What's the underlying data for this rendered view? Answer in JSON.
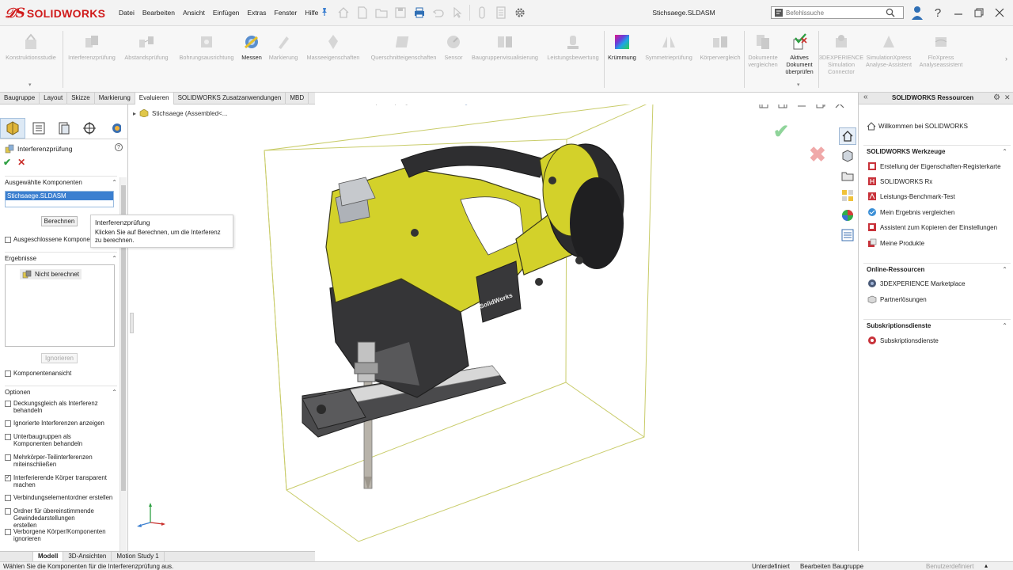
{
  "app": {
    "logo_text": "SOLIDWORKS",
    "document_title": "Stichsaege.SLDASM"
  },
  "menu": [
    "Datei",
    "Bearbeiten",
    "Ansicht",
    "Einfügen",
    "Extras",
    "Fenster",
    "Hilfe"
  ],
  "search": {
    "placeholder": "Befehlssuche"
  },
  "commands": [
    {
      "label": "Konstruktionsstudie",
      "enabled": false
    },
    {
      "label": "Interferenzprüfung",
      "enabled": false
    },
    {
      "label": "Abstandsprüfung",
      "enabled": false
    },
    {
      "label": "Bohrungsausrichtung",
      "enabled": false
    },
    {
      "label": "Messen",
      "enabled": true
    },
    {
      "label": "Markierung",
      "enabled": false
    },
    {
      "label": "Masseeigenschaften",
      "enabled": false
    },
    {
      "label": "Querschnitteigenschaften",
      "enabled": false
    },
    {
      "label": "Sensor",
      "enabled": false
    },
    {
      "label": "Baugruppenvisualisierung",
      "enabled": false
    },
    {
      "label": "Leistungsbewertung",
      "enabled": false
    },
    {
      "label": "Krümmung",
      "enabled": true
    },
    {
      "label": "Symmetrieprüfung",
      "enabled": false
    },
    {
      "label": "Körpervergleich",
      "enabled": false
    },
    {
      "label": "Dokumente vergleichen",
      "enabled": false
    },
    {
      "label": "Aktives Dokument überprüfen",
      "enabled": true
    },
    {
      "label": "3DEXPERIENCE Simulation Connector",
      "enabled": false
    },
    {
      "label": "SimulationXpress Analyse-Assistent",
      "enabled": false
    },
    {
      "label": "FloXpress Analyseassistent",
      "enabled": false
    }
  ],
  "tabs": [
    {
      "label": "Baugruppe",
      "selected": false
    },
    {
      "label": "Layout",
      "selected": false
    },
    {
      "label": "Skizze",
      "selected": false
    },
    {
      "label": "Markierung",
      "selected": false
    },
    {
      "label": "Evaluieren",
      "selected": true
    },
    {
      "label": "SOLIDWORKS Zusatzanwendungen",
      "selected": false
    },
    {
      "label": "MBD",
      "selected": false
    }
  ],
  "property_manager": {
    "title": "Interferenzprüfung",
    "help": "?",
    "ok": "✔",
    "cancel": "✕",
    "selected_components": {
      "header": "Ausgewählte Komponenten",
      "items": [
        "Stichsaege.SLDASM"
      ]
    },
    "calculate_button": "Berechnen",
    "excluded_components": "Ausgeschlossene Kompone",
    "results": {
      "header": "Ergebnisse",
      "items": [
        "Nicht berechnet"
      ]
    },
    "ignore_button": "Ignorieren",
    "component_view": "Komponentenansicht",
    "options": {
      "header": "Optionen",
      "items": [
        {
          "label": "Deckungsgleich als Interferenz behandeln",
          "checked": false
        },
        {
          "label": "Ignorierte Interferenzen anzeigen",
          "checked": false
        },
        {
          "label": "Unterbaugruppen als Komponenten behandeln",
          "checked": false
        },
        {
          "label": "Mehrkörper-Teilinterferenzen miteinschließen",
          "checked": false
        },
        {
          "label": "Interferierende Körper transparent machen",
          "checked": true
        },
        {
          "label": "Verbindungselementordner erstellen",
          "checked": false
        },
        {
          "label": "Ordner für übereinstimmende Gewindedarstellungen erstellen",
          "checked": false
        },
        {
          "label": "Verborgene Körper/Komponenten ignorieren",
          "checked": false
        }
      ]
    }
  },
  "tooltip": {
    "title": "Interferenzprüfung",
    "body": "Klicken Sie auf Berechnen, um die Interferenz zu berechnen."
  },
  "feature_tree": {
    "root": "Stichsaege  (Assembled<..."
  },
  "model": {
    "brand_label": "SolidWorks",
    "body_color": "#d3d12a",
    "dark_color": "#2e2e30"
  },
  "task_pane": {
    "title": "SOLIDWORKS Ressourcen",
    "welcome": "Willkommen bei SOLIDWORKS",
    "sections": [
      {
        "header": "SOLIDWORKS Werkzeuge",
        "items": [
          "Erstellung der Eigenschaften-Registerkarte",
          "SOLIDWORKS Rx",
          "Leistungs-Benchmark-Test",
          "Mein Ergebnis vergleichen",
          "Assistent zum Kopieren der Einstellungen",
          "Meine Produkte"
        ]
      },
      {
        "header": "Online-Ressourcen",
        "items": [
          "3DEXPERIENCE Marketplace",
          "Partnerlösungen"
        ]
      },
      {
        "header": "Subskriptionsdienste",
        "items": [
          "Subskriptionsdienste"
        ]
      }
    ]
  },
  "bottom_tabs": [
    {
      "label": "Modell",
      "selected": true
    },
    {
      "label": "3D-Ansichten",
      "selected": false
    },
    {
      "label": "Motion Study 1",
      "selected": false
    }
  ],
  "status": {
    "message": "Wählen Sie die Komponenten für die Interferenzprüfung aus.",
    "state": "Unterdefiniert",
    "mode": "Bearbeiten Baugruppe",
    "units": "Benutzerdefiniert"
  },
  "colors": {
    "accent": "#3b7fd0",
    "brand_red": "#d01a1a",
    "ok_green": "#2ea043",
    "cancel_red": "#c9302c"
  }
}
